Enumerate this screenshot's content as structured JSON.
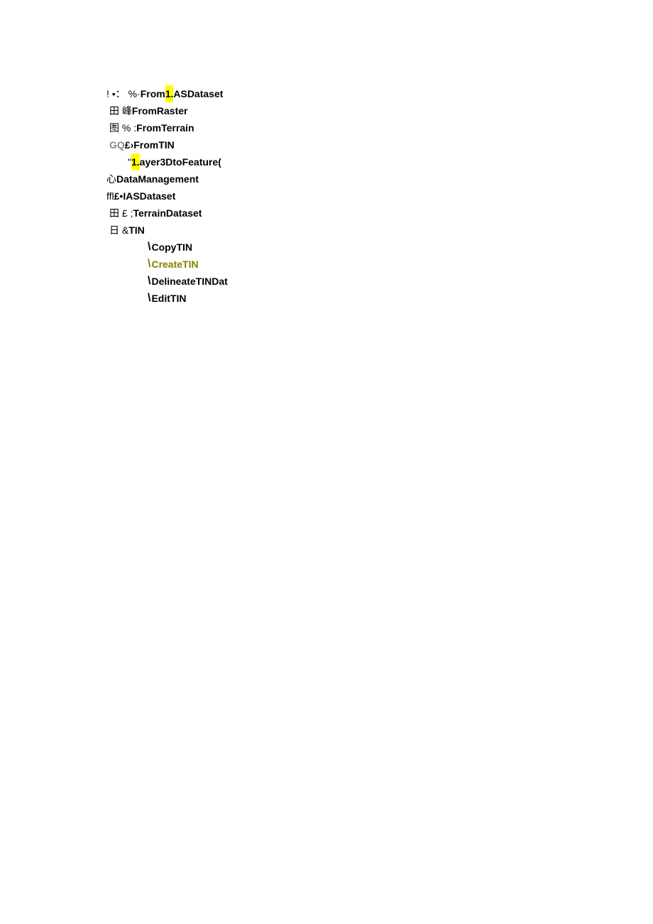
{
  "tree": {
    "item1": {
      "prefix": "!  •：   %·",
      "text_a": "From",
      "text_hl": "1.",
      "text_b": "ASDataset"
    },
    "item2": {
      "prefix": "田 峰",
      "text": "FromRaster"
    },
    "item3": {
      "prefix": "图 % :  ",
      "text": "FromTerrain"
    },
    "item4": {
      "prefix": "GQ",
      "mid": "£›",
      "text": "FromTIN"
    },
    "item5": {
      "prefix": "\"",
      "text_hl": "1.",
      "text_b": "ayer3DtoFeature(",
      "text_a": ""
    },
    "item6": {
      "prefix": "心",
      "text": "DataManagement"
    },
    "item7": {
      "prefix": "ffl",
      "mid": "£•",
      "text": "IASDataset"
    },
    "item8": {
      "prefix": "田 £ ;  ",
      "text": "TerrainDataset"
    },
    "item9": {
      "prefix": "日 &",
      "text": "TIN"
    },
    "item10": {
      "text": "CopyTIN"
    },
    "item11": {
      "text": "CreateTIN"
    },
    "item12": {
      "text": "DelineateTINDat"
    },
    "item13": {
      "text": "EditTIN"
    }
  }
}
